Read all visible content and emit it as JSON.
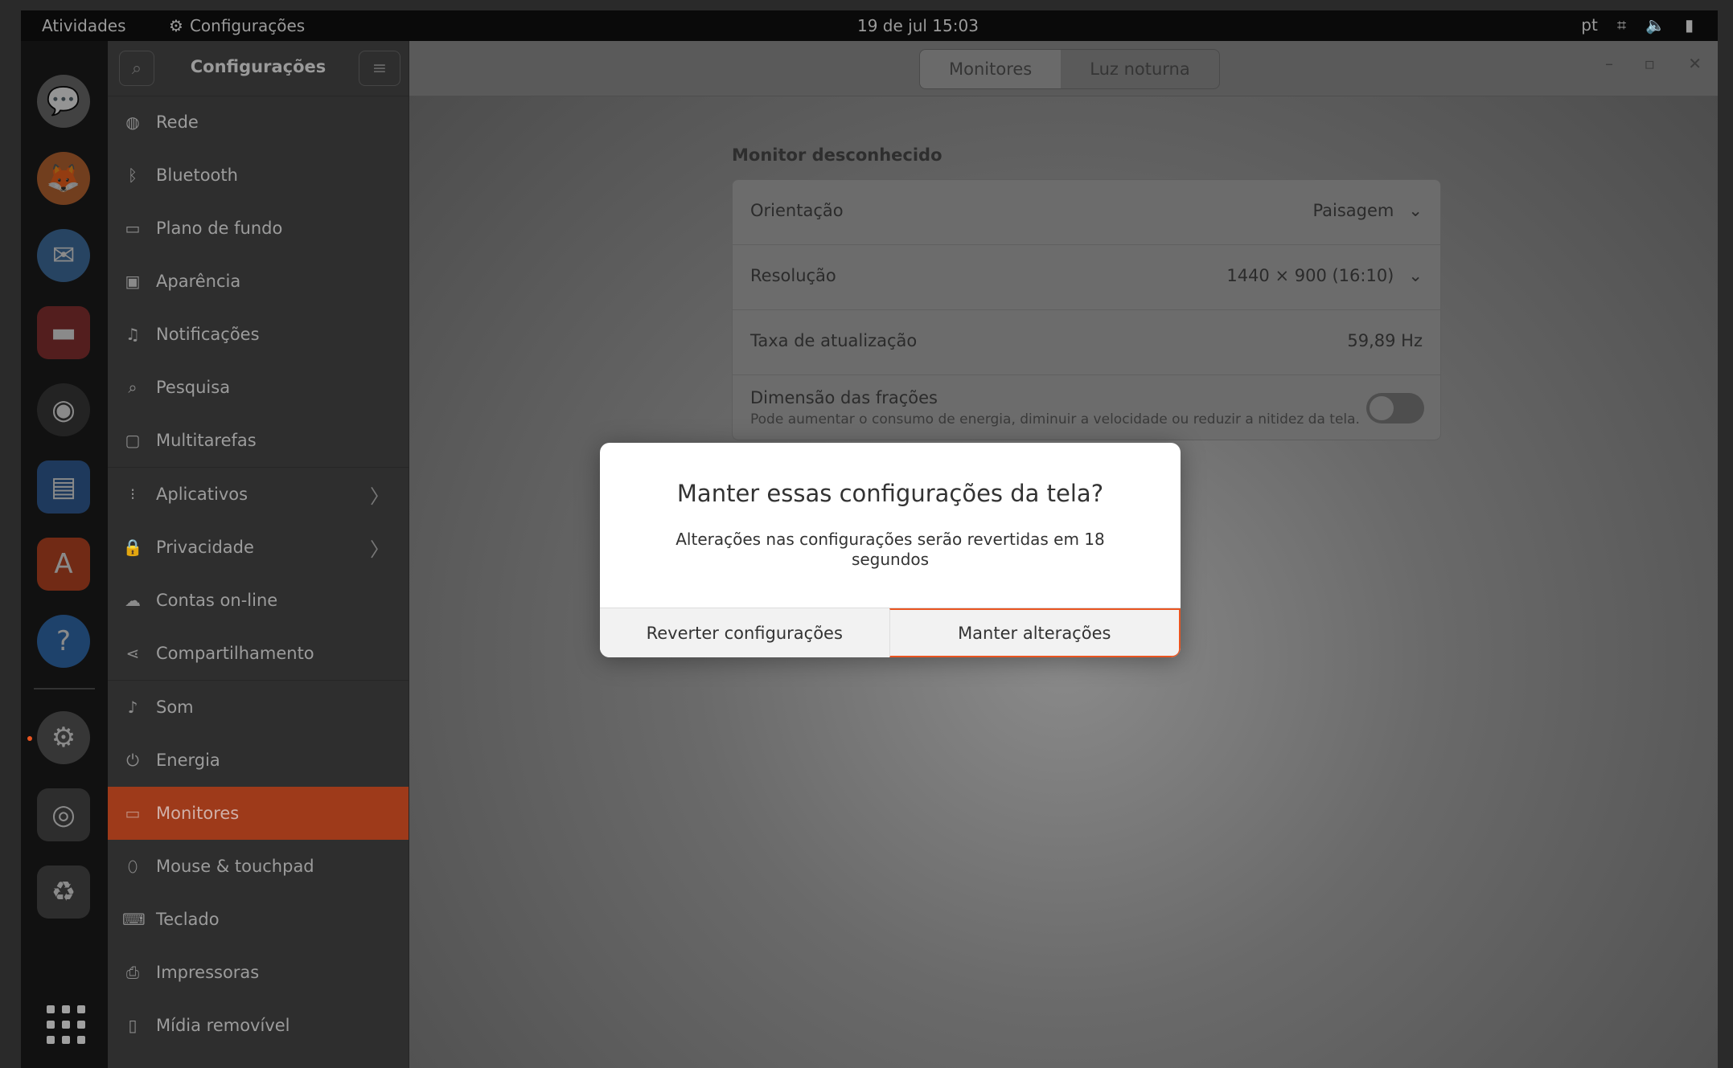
{
  "topbar": {
    "activities": "Atividades",
    "app_name": "Configurações",
    "clock": "19 de jul  15:03",
    "lang": "pt"
  },
  "sidebar": {
    "title": "Configurações",
    "items": [
      {
        "label": "Rede",
        "icon": "globe-icon"
      },
      {
        "label": "Bluetooth",
        "icon": "bluetooth-icon"
      },
      {
        "label": "Plano de fundo",
        "icon": "wallpaper-icon"
      },
      {
        "label": "Aparência",
        "icon": "appearance-icon"
      },
      {
        "label": "Notificações",
        "icon": "bell-icon"
      },
      {
        "label": "Pesquisa",
        "icon": "search-icon"
      },
      {
        "label": "Multitarefas",
        "icon": "multitask-icon"
      },
      {
        "label": "Aplicativos",
        "icon": "apps-grid-icon"
      },
      {
        "label": "Privacidade",
        "icon": "lock-icon"
      },
      {
        "label": "Contas on-line",
        "icon": "cloud-icon"
      },
      {
        "label": "Compartilhamento",
        "icon": "share-icon"
      },
      {
        "label": "Som",
        "icon": "music-note-icon"
      },
      {
        "label": "Energia",
        "icon": "power-icon"
      },
      {
        "label": "Monitores",
        "icon": "monitor-icon"
      },
      {
        "label": "Mouse & touchpad",
        "icon": "mouse-icon"
      },
      {
        "label": "Teclado",
        "icon": "keyboard-icon"
      },
      {
        "label": "Impressoras",
        "icon": "printer-icon"
      },
      {
        "label": "Mídia removível",
        "icon": "removable-media-icon"
      }
    ],
    "active_item": "Monitores"
  },
  "header": {
    "tabs": [
      "Monitores",
      "Luz noturna"
    ],
    "active_tab": "Monitores"
  },
  "display": {
    "section_title": "Monitor desconhecido",
    "orientation_label": "Orientação",
    "orientation_value": "Paisagem",
    "resolution_label": "Resolução",
    "resolution_value": "1440 × 900 (16:10)",
    "refresh_label": "Taxa de atualização",
    "refresh_value": "59,89 Hz",
    "fractional_label": "Dimensão das frações",
    "fractional_desc": "Pode aumentar o consumo de energia, diminuir a velocidade ou reduzir a nitidez da tela.",
    "fractional_enabled": false
  },
  "dialog": {
    "title": "Manter essas configurações da tela?",
    "body": "Alterações nas configurações serão revertidas em 18 segundos",
    "revert_label": "Reverter configurações",
    "keep_label": "Manter alterações"
  },
  "colors": {
    "accent": "#e95420",
    "active_sidebar": "#9e3a1a"
  }
}
